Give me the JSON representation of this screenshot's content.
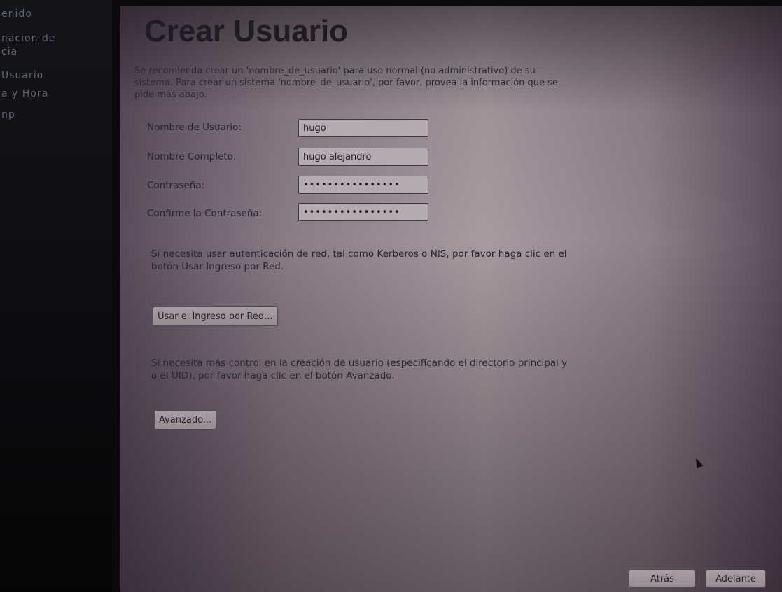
{
  "sidebar": {
    "items": [
      {
        "label": "enido"
      },
      {
        "label": "nacion de"
      },
      {
        "label": "cia"
      },
      {
        "label": "Usuario"
      },
      {
        "label": "a y Hora"
      },
      {
        "label": "np"
      }
    ]
  },
  "page": {
    "title": "Crear Usuario",
    "intro": "Se recomienda crear un 'nombre_de_usuario' para uso normal (no administrativo) de su sistema. Para crear un sistema 'nombre_de_usuario', por favor, provea la información que se pide más abajo."
  },
  "form": {
    "username_label": "Nombre de Usuario:",
    "username_value": "hugo",
    "fullname_label": "Nombre Completo:",
    "fullname_value": "hugo alejandro",
    "password_label": "Contraseña:",
    "password_value": "••••••••••••••••",
    "confirm_label": "Confirme la Contraseña:",
    "confirm_value": "••••••••••••••••"
  },
  "network": {
    "note": "Si necesita usar autenticación de red, tal como Kerberos o NIS, por favor haga clic en el botón Usar Ingreso por Red.",
    "button_label": "Usar el Ingreso por Red..."
  },
  "advanced": {
    "note": "Si necesita más control en la creación de usuario (especificando el directorio principal y o el UID), por favor haga clic en el botón Avanzado.",
    "button_label": "Avanzado..."
  },
  "nav": {
    "back_label": "Atrás",
    "next_label": "Adelante"
  },
  "cursor_icon": "arrow-pointer-icon"
}
